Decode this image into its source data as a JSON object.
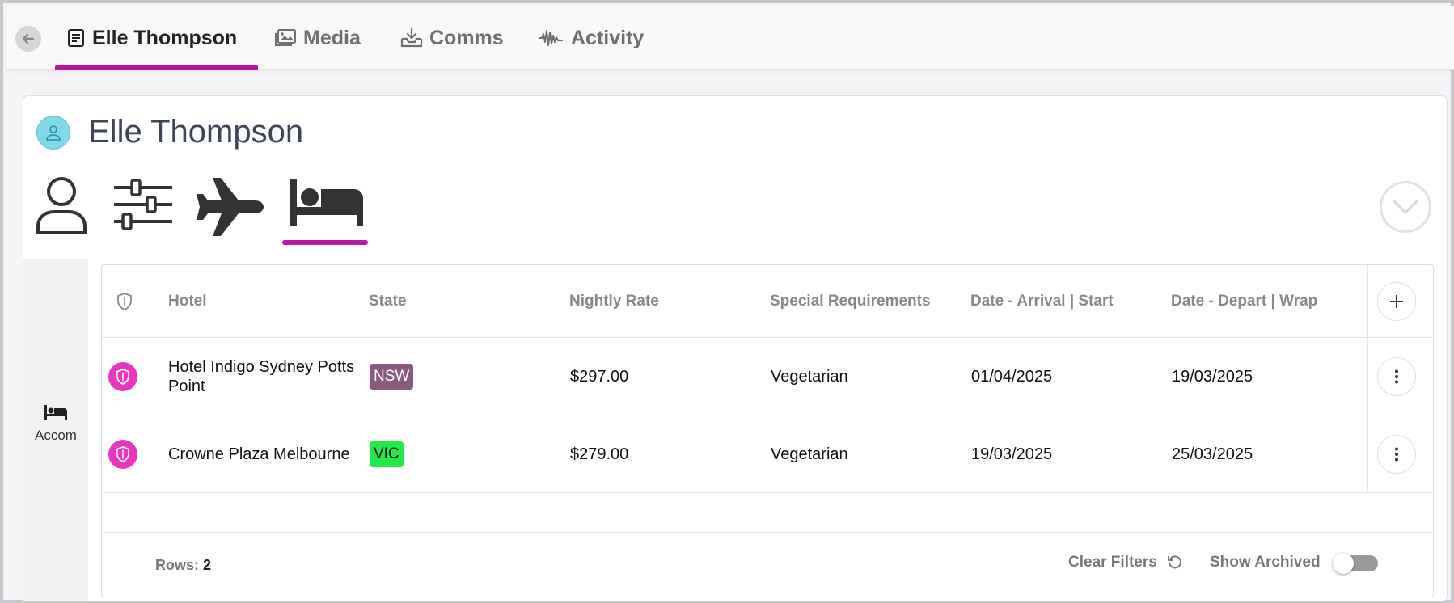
{
  "nav": {
    "tabs": [
      {
        "label": "Elle Thompson",
        "icon": "document-icon",
        "active": true
      },
      {
        "label": "Media",
        "icon": "image-icon",
        "active": false
      },
      {
        "label": "Comms",
        "icon": "inbox-download-icon",
        "active": false
      },
      {
        "label": "Activity",
        "icon": "waveform-icon",
        "active": false
      }
    ],
    "accent": "#b5179e"
  },
  "profile": {
    "name": "Elle Thompson",
    "sections": [
      "person-icon",
      "sliders-icon",
      "airplane-icon",
      "bed-icon"
    ],
    "active_section": "bed-icon"
  },
  "sidebar": {
    "items": [
      {
        "label": "Accom",
        "icon": "bed-icon"
      }
    ]
  },
  "table": {
    "columns": [
      "Hotel",
      "State",
      "Nightly Rate",
      "Special Requirements",
      "Date - Arrival | Start",
      "Date - Depart | Wrap"
    ],
    "rows": [
      {
        "hotel": "Hotel Indigo Sydney Potts Point",
        "state": "NSW",
        "state_color": "#8a5a7e",
        "state_text_color": "#ffffff",
        "rate": "$297.00",
        "requirements": "Vegetarian",
        "arrival": "01/04/2025",
        "depart": "19/03/2025"
      },
      {
        "hotel": "Crowne Plaza Melbourne",
        "state": "VIC",
        "state_color": "#22e84a",
        "state_text_color": "#111111",
        "rate": "$279.00",
        "requirements": "Vegetarian",
        "arrival": "19/03/2025",
        "depart": "25/03/2025"
      }
    ]
  },
  "footer": {
    "rows_label": "Rows:",
    "rows_count": "2",
    "clear_filters": "Clear Filters",
    "show_archived": "Show Archived",
    "show_archived_on": false
  }
}
